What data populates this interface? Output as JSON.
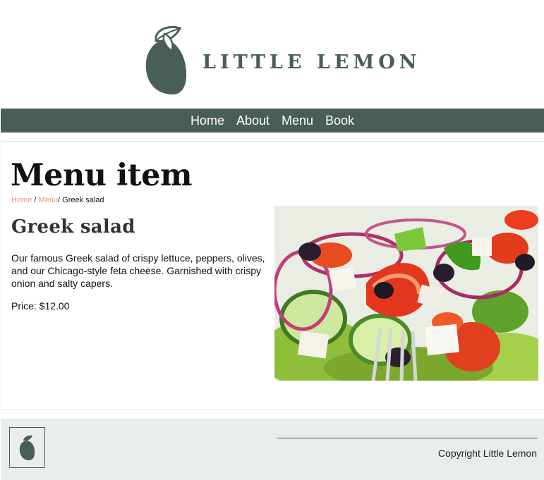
{
  "header": {
    "brand": "LITTLE LEMON",
    "logo_icon": "lemon-icon",
    "brand_color": "#495e57"
  },
  "nav": {
    "items": [
      {
        "label": "Home"
      },
      {
        "label": "About"
      },
      {
        "label": "Menu"
      },
      {
        "label": "Book"
      }
    ],
    "background": "#495e57"
  },
  "main": {
    "page_title": "Menu item",
    "breadcrumb": {
      "home": "Home",
      "sep1": " / ",
      "menu": "Menu",
      "sep2": "/ ",
      "current": "Greek salad"
    },
    "dish_title": "Greek salad",
    "description": "Our famous Greek salad of crispy lettuce, peppers, olives, and our Chicago-style feta cheese. Garnished with crispy onion and salty capers.",
    "price": "Price: $12.00",
    "image_icon": "greek-salad-image",
    "link_color": "#ee9972"
  },
  "footer": {
    "logo_icon": "lemon-icon",
    "copyright": "Copyright Little Lemon",
    "background": "#eaeded"
  }
}
